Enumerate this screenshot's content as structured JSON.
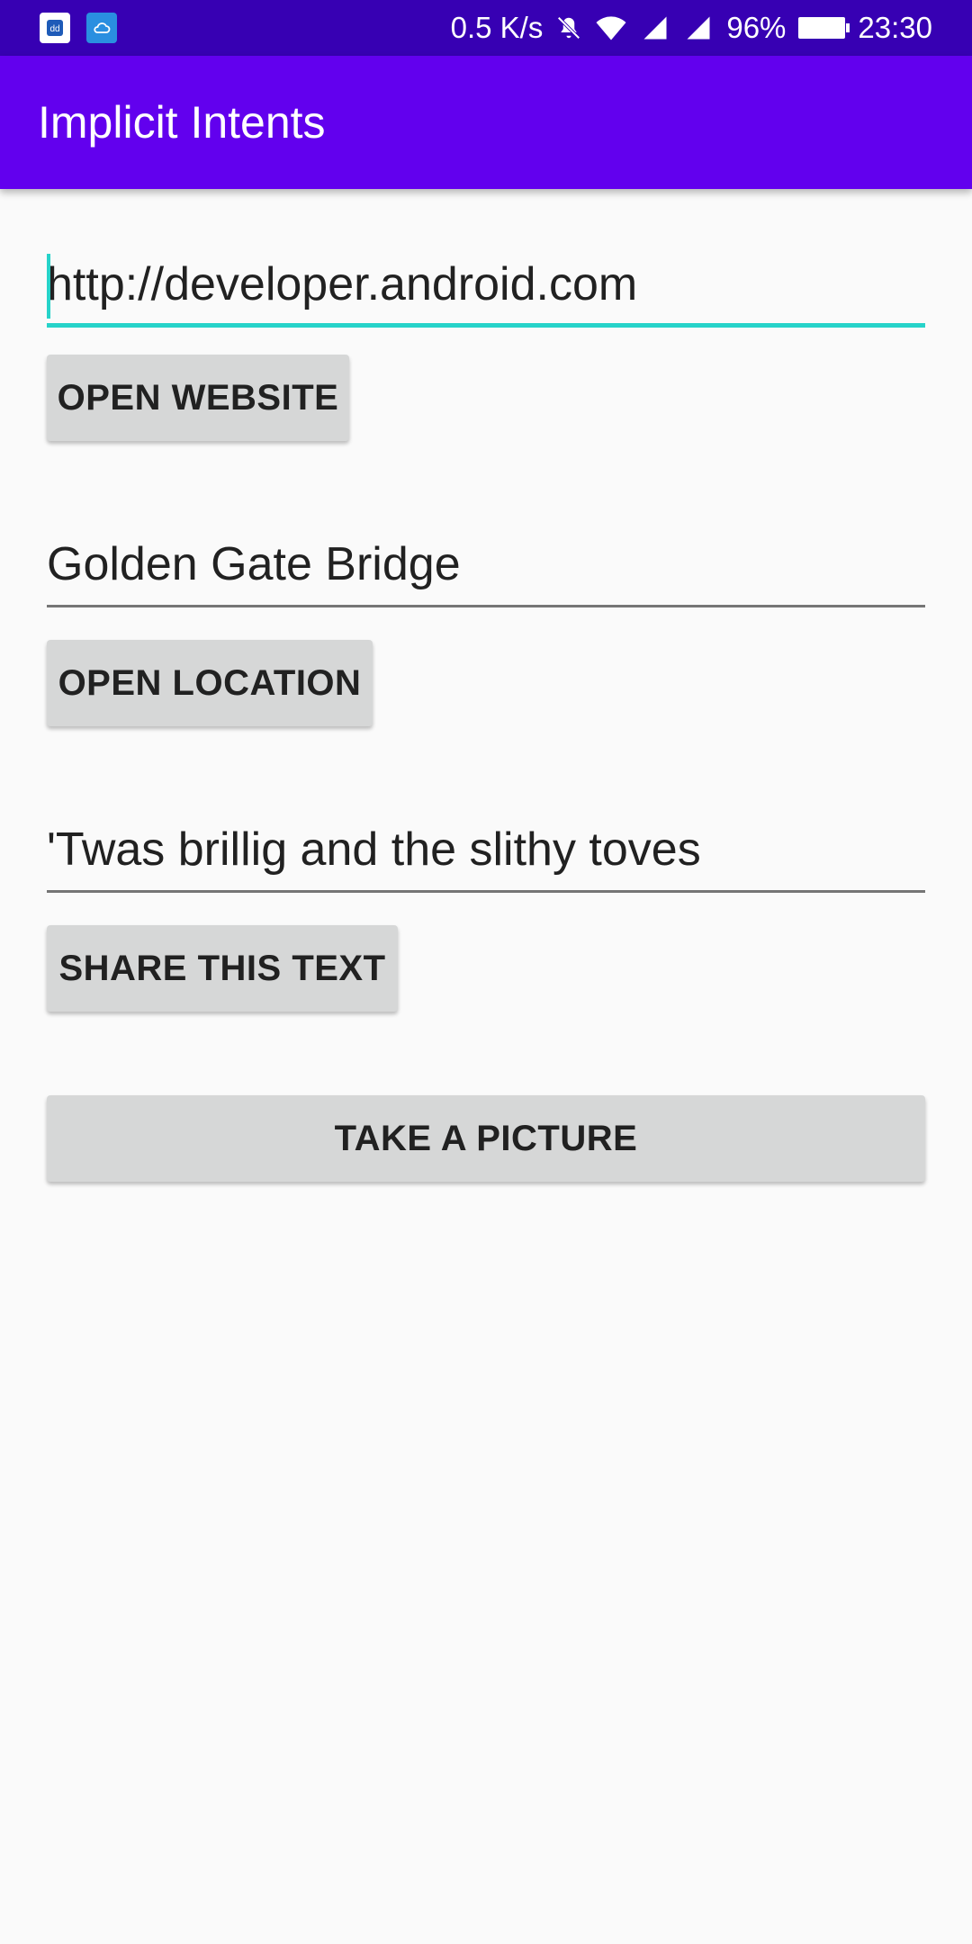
{
  "status_bar": {
    "net_speed": "0.5 K/s",
    "battery": "96%",
    "time": "23:30",
    "icons": [
      "app-notification-icon",
      "cloud-icon",
      "mute-bell-icon",
      "wifi-icon",
      "signal-icon",
      "signal-icon",
      "battery-icon"
    ]
  },
  "app_bar": {
    "title": "Implicit Intents",
    "color": "#6200ee"
  },
  "website": {
    "value": "http://developer.android.com",
    "button": "OPEN WEBSITE"
  },
  "location": {
    "value": "Golden Gate Bridge",
    "button": "OPEN LOCATION"
  },
  "share": {
    "value": "'Twas brillig and the slithy toves",
    "button": "SHARE THIS TEXT"
  },
  "picture": {
    "button": "TAKE A PICTURE"
  },
  "colors": {
    "status_bar": "#3700b3",
    "accent": "#26d3c9",
    "button_bg": "#d6d7d7"
  }
}
